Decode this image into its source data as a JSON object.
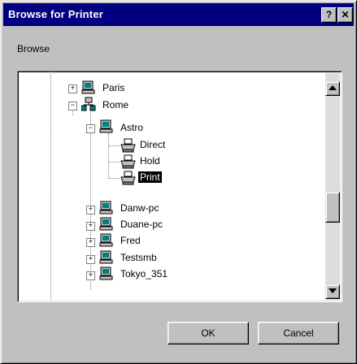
{
  "window": {
    "title": "Browse for Printer",
    "help_glyph": "?",
    "close_glyph": "✕"
  },
  "prompt": "Browse",
  "tree": {
    "nodes": [
      {
        "label": "Paris",
        "icon": "computer-icon",
        "expander": "+"
      },
      {
        "label": "Rome",
        "icon": "network-icon",
        "expander": "−"
      },
      {
        "label": "Astro",
        "icon": "computer-icon",
        "expander": "−"
      },
      {
        "label": "Direct",
        "icon": "printer-icon"
      },
      {
        "label": "Hold",
        "icon": "printer-icon"
      },
      {
        "label": "Print",
        "icon": "printer-icon",
        "selected": true
      },
      {
        "label": "Danw-pc",
        "icon": "computer-icon",
        "expander": "+"
      },
      {
        "label": "Duane-pc",
        "icon": "computer-icon",
        "expander": "+"
      },
      {
        "label": "Fred",
        "icon": "computer-icon",
        "expander": "+"
      },
      {
        "label": "Testsmb",
        "icon": "computer-icon",
        "expander": "+"
      },
      {
        "label": "Tokyo_351",
        "icon": "computer-icon",
        "expander": "+"
      }
    ]
  },
  "buttons": {
    "ok": "OK",
    "cancel": "Cancel"
  }
}
